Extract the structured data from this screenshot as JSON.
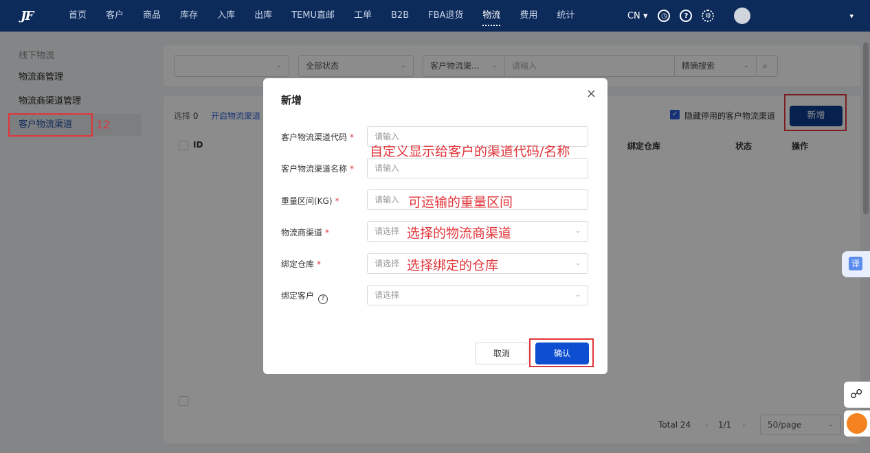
{
  "nav": {
    "logo": "JF",
    "items": [
      "首页",
      "客户",
      "商品",
      "库存",
      "入库",
      "出库",
      "TEMU直邮",
      "工单",
      "B2B",
      "FBA退货",
      "物流",
      "费用",
      "统计"
    ],
    "active_index": 10,
    "lang": "CN",
    "lang_caret": "▾",
    "user_caret": "▾"
  },
  "sidebar": {
    "group": "线下物流",
    "items": [
      "物流商管理",
      "物流商渠道管理",
      "客户物流渠道"
    ],
    "active_index": 2,
    "annotation": "12"
  },
  "filters": {
    "status": "全部状态",
    "field": "客户物流渠...",
    "placeholder": "请输入",
    "mode": "精确搜索"
  },
  "toolbar": {
    "selected_label": "选择",
    "selected_count": "0",
    "enable_link": "开启物流渠道",
    "hide_disabled": "隐藏停用的客户物流渠道",
    "add_button": "新增"
  },
  "table": {
    "headers": [
      "ID",
      "绑定仓库",
      "状态",
      "操作"
    ]
  },
  "pagination": {
    "total": "Total 24",
    "pages": "1/1",
    "page_size": "50/page"
  },
  "modal": {
    "title": "新增",
    "close": "×",
    "fields": [
      {
        "label": "客户物流渠道代码",
        "required": true,
        "placeholder": "请输入",
        "type": "input"
      },
      {
        "label": "客户物流渠道名称",
        "required": true,
        "placeholder": "请输入",
        "type": "input"
      },
      {
        "label": "重量区间(KG)",
        "required": true,
        "placeholder": "请输入",
        "type": "input"
      },
      {
        "label": "物流商渠道",
        "required": true,
        "placeholder": "请选择",
        "type": "select"
      },
      {
        "label": "绑定仓库",
        "required": true,
        "placeholder": "请选择",
        "type": "select"
      },
      {
        "label": "绑定客户",
        "required": false,
        "placeholder": "请选择",
        "type": "select",
        "help": "?"
      }
    ],
    "annotations": [
      "自定义显示给客户的渠道代码/名称",
      "可运输的重量区间",
      "选择的物流商渠道",
      "选择绑定的仓库"
    ],
    "cancel": "取消",
    "confirm": "确认"
  },
  "floating": {
    "translate": "译"
  },
  "colors": {
    "nav_bg": "#0c2a5a",
    "primary": "#0d4fd0",
    "annotation_red": "#e0353b"
  }
}
